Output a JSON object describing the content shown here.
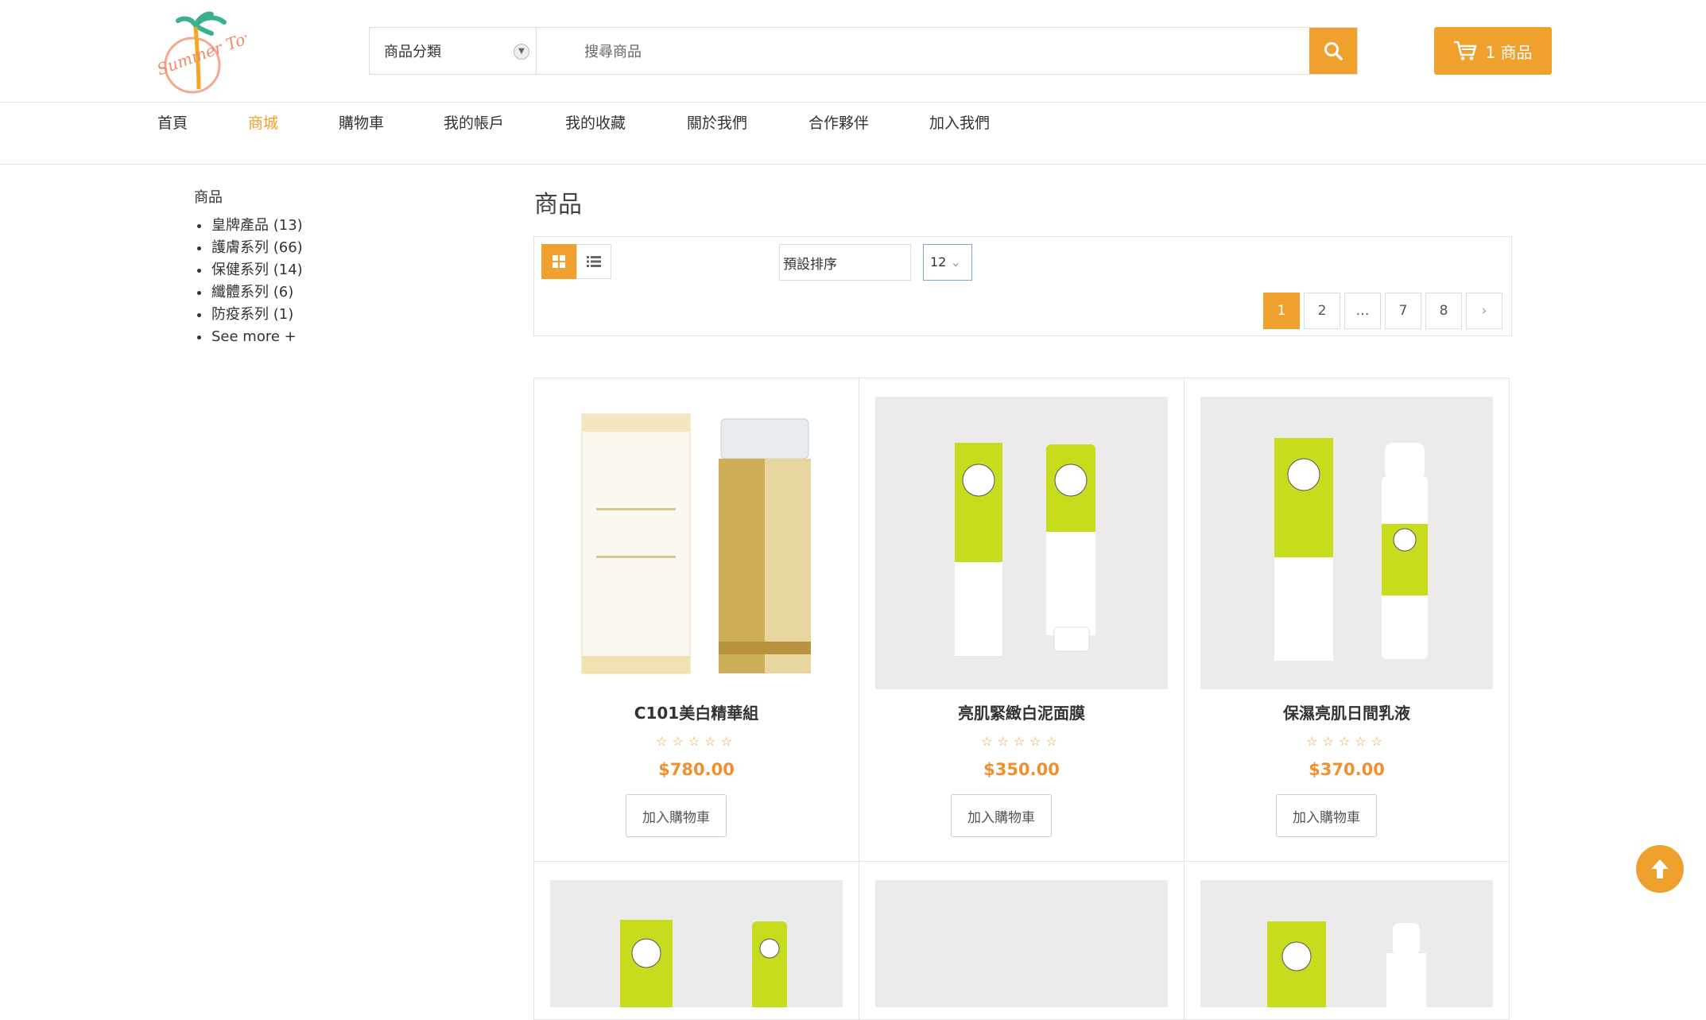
{
  "brand": {
    "logo_text": "Summer Town"
  },
  "header": {
    "category_select": "商品分類",
    "search_placeholder": "搜尋商品",
    "cart_label": "1 商品"
  },
  "nav": {
    "items": [
      {
        "label": "首頁"
      },
      {
        "label": "商城",
        "active": true
      },
      {
        "label": "購物車"
      },
      {
        "label": "我的帳戶"
      },
      {
        "label": "我的收藏"
      },
      {
        "label": "關於我們"
      },
      {
        "label": "合作夥伴"
      },
      {
        "label": "加入我們"
      }
    ]
  },
  "sidebar": {
    "title": "商品",
    "items": [
      {
        "label": "皇牌產品",
        "count": "(13)"
      },
      {
        "label": "護膚系列",
        "count": "(66)"
      },
      {
        "label": "保健系列",
        "count": "(14)"
      },
      {
        "label": "纖體系列",
        "count": "(6)"
      },
      {
        "label": "防疫系列",
        "count": "(1)"
      },
      {
        "label": "See more +"
      }
    ]
  },
  "main": {
    "title": "商品",
    "sort_label": "預設排序",
    "per_page": "12",
    "pagination": [
      "1",
      "2",
      "…",
      "7",
      "8"
    ],
    "current_page": "1"
  },
  "products": [
    {
      "name": "C101美白精華組",
      "price": "$780.00",
      "stars": "☆☆☆☆☆",
      "add_label": "加入購物車"
    },
    {
      "name": "亮肌緊緻白泥面膜",
      "price": "$350.00",
      "stars": "☆☆☆☆☆",
      "add_label": "加入購物車"
    },
    {
      "name": "保濕亮肌日間乳液",
      "price": "$370.00",
      "stars": "☆☆☆☆☆",
      "add_label": "加入購物車"
    }
  ],
  "colors": {
    "accent": "#f0a02c",
    "price": "#f0902c",
    "product_lime": "#c8dc1e"
  }
}
